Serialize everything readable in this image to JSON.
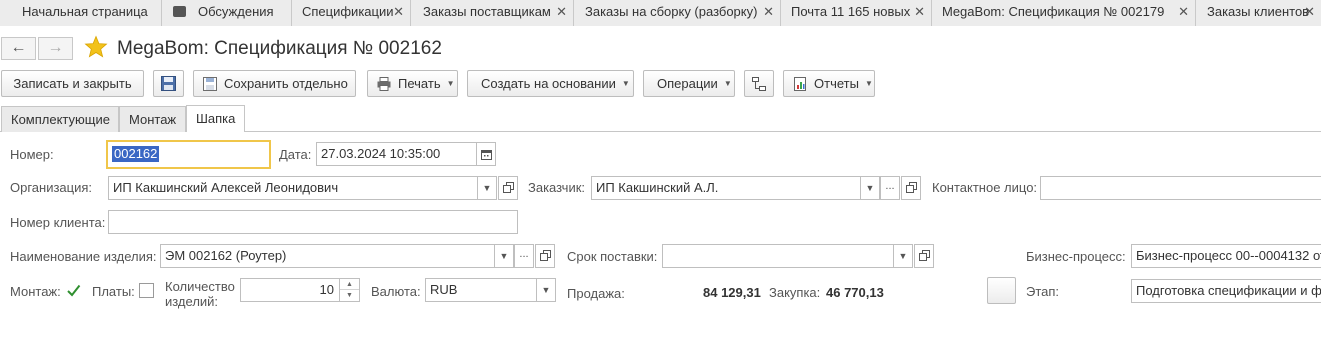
{
  "window_tabs": [
    {
      "label": "Начальная страница",
      "closable": false
    },
    {
      "label": "Обсуждения",
      "closable": false
    },
    {
      "label": "Спецификации",
      "closable": true
    },
    {
      "label": "Заказы поставщикам",
      "closable": true
    },
    {
      "label": "Заказы на сборку (разборку)",
      "closable": true
    },
    {
      "label": "Почта 11 165 новых",
      "closable": true
    },
    {
      "label": "MegaBom: Спецификация № 002179",
      "closable": true
    },
    {
      "label": "Заказы клиентов",
      "closable": true
    }
  ],
  "close_glyph": "✕",
  "nav": {
    "back": "←",
    "forward": "→"
  },
  "page": {
    "title": "MegaBom: Спецификация № 002162"
  },
  "toolbar": {
    "save_close": "Записать и закрыть",
    "save_separately": "Сохранить отдельно",
    "print": "Печать",
    "create_based_on": "Создать на основании",
    "operations": "Операции",
    "reports": "Отчеты",
    "dropdown_glyph": "▼"
  },
  "form_tabs": [
    {
      "label": "Комплектующие",
      "active": false
    },
    {
      "label": "Монтаж",
      "active": false
    },
    {
      "label": "Шапка",
      "active": true
    }
  ],
  "form": {
    "number_label": "Номер:",
    "number_value": "002162",
    "date_label": "Дата:",
    "date_value": "27.03.2024 10:35:00",
    "org_label": "Организация:",
    "org_value": "ИП Какшинский Алексей Леонидович",
    "customer_label": "Заказчик:",
    "customer_value": "ИП Какшинский А.Л.",
    "contact_label": "Контактное лицо:",
    "contact_value": "",
    "client_number_label": "Номер клиента:",
    "client_number_value": "",
    "product_label": "Наименование изделия:",
    "product_value": "ЭМ 002162 (Роутер)",
    "delivery_label": "Срок поставки:",
    "delivery_value": "",
    "business_process_label": "Бизнес-процесс:",
    "business_process_value": "Бизнес-процесс 00--0004132 от",
    "mount_label": "Монтаж:",
    "mount_checked": true,
    "boards_label": "Платы:",
    "boards_checked": false,
    "qty_label_line1": "Количество",
    "qty_label_line2": "изделий:",
    "qty_value": "10",
    "currency_label": "Валюта:",
    "currency_value": "RUB",
    "sale_label": "Продажа:",
    "sale_value": "84 129,31",
    "purchase_label": "Закупка:",
    "purchase_value": "46 770,13",
    "stage_label": "Этап:",
    "stage_value": "Подготовка спецификации и фа",
    "dots_glyph": "..."
  },
  "colors": {
    "accent_star": "#f2c21b",
    "selection": "#3a67c4",
    "focus_border": "#f0c64a"
  }
}
